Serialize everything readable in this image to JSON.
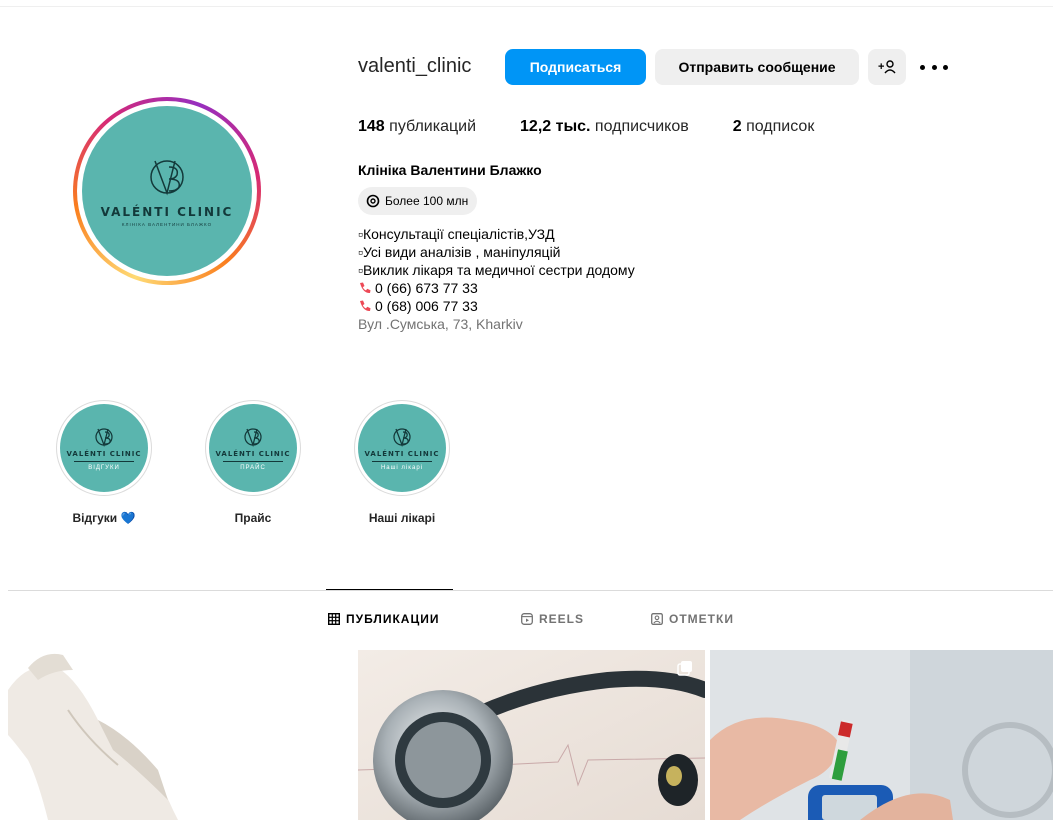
{
  "profile": {
    "username": "valenti_clinic",
    "follow_label": "Подписаться",
    "message_label": "Отправить сообщение",
    "add_user_label": "+",
    "stats": {
      "posts_count": "148",
      "posts_label": "публикаций",
      "followers_count": "12,2 тыс.",
      "followers_label": "подписчиков",
      "following_count": "2",
      "following_label": "подписок"
    },
    "full_name": "Клініка Валентини Блажко",
    "threads_badge": "Более 100 млн",
    "bio": [
      "▫Консультації спеціалістів,УЗД",
      "▫Усі види аналізів , маніпуляцій",
      "▫Виклик лікаря та медичної сестри додому"
    ],
    "phones": [
      "0 (66) 673 77 33",
      "0 (68) 006 77 33"
    ],
    "address": "Вул .Сумська, 73, Kharkiv"
  },
  "avatar": {
    "logo_text": "VALÉNTI CLINIC",
    "logo_sub": "КЛІНІКА ВАЛЕНТИНИ БЛАЖКО",
    "color": "#5ab5ae"
  },
  "highlights": [
    {
      "label": "Відгуки 💙",
      "logo_text": "VALÉNTI CLINIC",
      "caption": "ВІДГУКИ"
    },
    {
      "label": "Прайс",
      "logo_text": "VALÉNTI CLINIC",
      "caption": "ПРАЙС"
    },
    {
      "label": "Наші лікарі",
      "logo_text": "VALÉNTI CLINIC",
      "caption": "Наші лікарі"
    }
  ],
  "tabs": [
    {
      "label": "ПУБЛИКАЦИИ",
      "icon": "grid-icon",
      "active": true
    },
    {
      "label": "REELS",
      "icon": "reels-icon",
      "active": false
    },
    {
      "label": "ОТМЕТКИ",
      "icon": "tagged-icon",
      "active": false
    }
  ],
  "colors": {
    "primary_button": "#0095f6",
    "secondary_button": "#efefef",
    "brand_teal": "#5ab5ae",
    "muted_text": "#737373",
    "phone_icon": "#ed4956"
  }
}
